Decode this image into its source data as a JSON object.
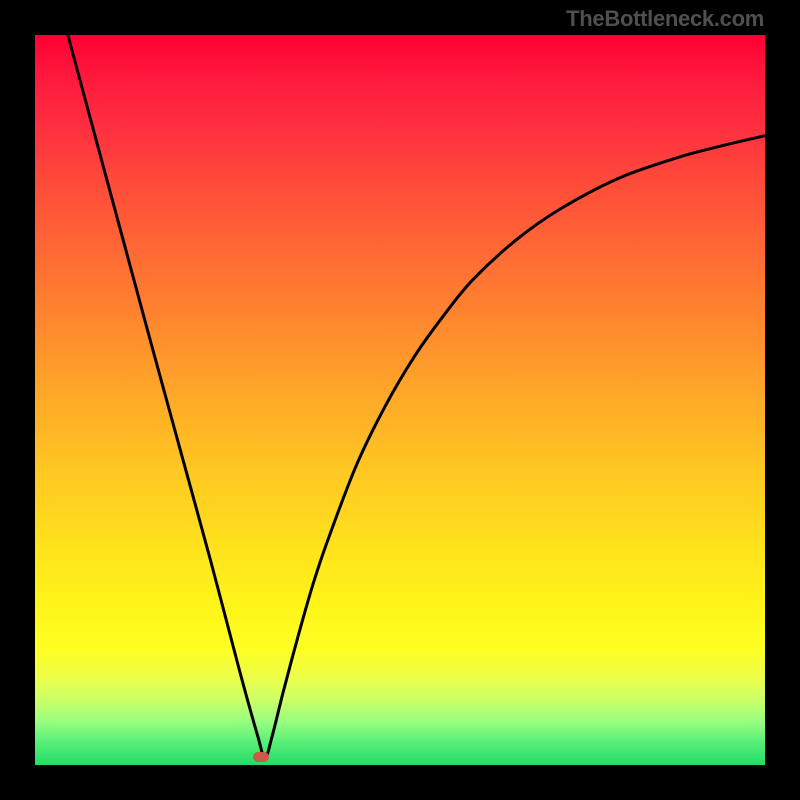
{
  "attribution": "TheBottleneck.com",
  "marker": {
    "color": "#cc5a4a",
    "x_frac": 0.31,
    "y_frac": 0.989
  },
  "chart_data": {
    "type": "line",
    "title": "",
    "xlabel": "",
    "ylabel": "",
    "xlim": [
      0,
      1
    ],
    "ylim": [
      0,
      1
    ],
    "grid": false,
    "axes_visible": false,
    "series": [
      {
        "name": "bottleneck-curve",
        "x": [
          0.045,
          0.08,
          0.12,
          0.16,
          0.2,
          0.24,
          0.28,
          0.305,
          0.315,
          0.325,
          0.34,
          0.36,
          0.38,
          0.4,
          0.44,
          0.48,
          0.52,
          0.56,
          0.6,
          0.66,
          0.72,
          0.8,
          0.88,
          0.94,
          1.0
        ],
        "y": [
          1.0,
          0.87,
          0.722,
          0.574,
          0.428,
          0.282,
          0.13,
          0.04,
          0.01,
          0.04,
          0.1,
          0.175,
          0.245,
          0.305,
          0.41,
          0.492,
          0.56,
          0.616,
          0.665,
          0.72,
          0.762,
          0.804,
          0.832,
          0.848,
          0.862
        ]
      }
    ],
    "annotations": [
      {
        "type": "marker",
        "x": 0.31,
        "y": 0.011,
        "color": "#cc5a4a",
        "shape": "rounded-rect"
      }
    ],
    "background": "red-yellow-green vertical gradient"
  }
}
